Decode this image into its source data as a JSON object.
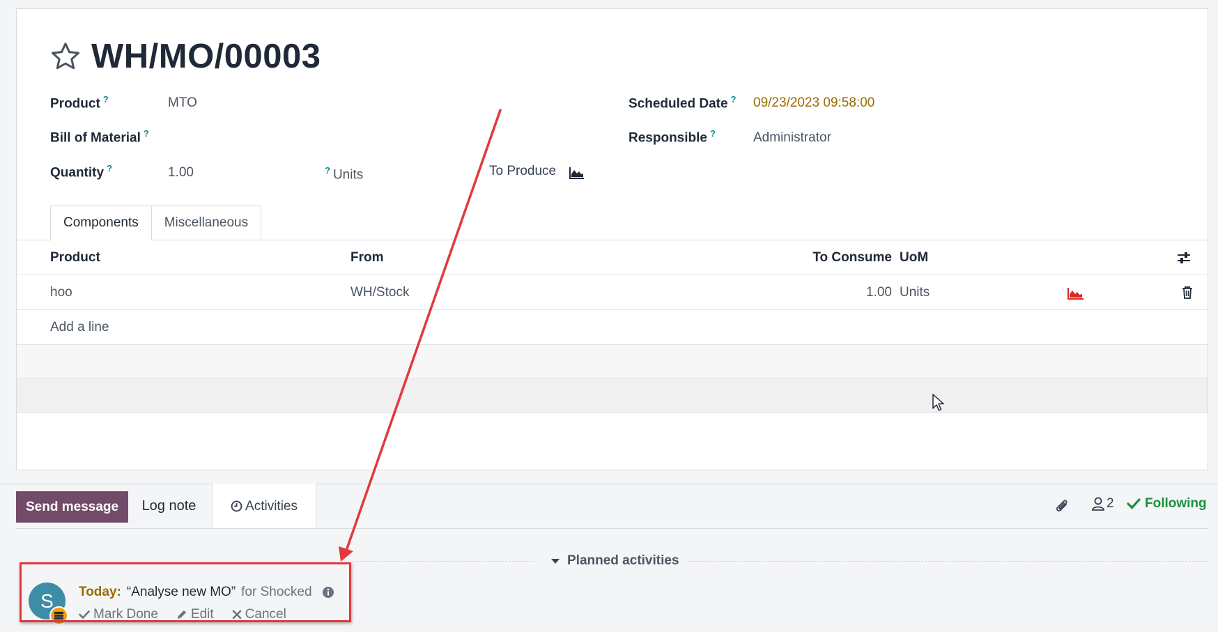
{
  "record": {
    "title": "WH/MO/00003",
    "fields": {
      "product_label": "Product",
      "product_value": "MTO",
      "bom_label": "Bill of Material",
      "quantity_label": "Quantity",
      "quantity_value": "1.00",
      "quantity_uom": "Units",
      "to_produce_label": "To Produce",
      "scheduled_label": "Scheduled Date",
      "scheduled_value": "09/23/2023 09:58:00",
      "responsible_label": "Responsible",
      "responsible_value": "Administrator",
      "help_mark": "?"
    }
  },
  "tabs": [
    {
      "label": "Components",
      "active": true
    },
    {
      "label": "Miscellaneous",
      "active": false
    }
  ],
  "components_table": {
    "headers": {
      "product": "Product",
      "from": "From",
      "to_consume": "To Consume",
      "uom": "UoM"
    },
    "rows": [
      {
        "product": "hoo",
        "from": "WH/Stock",
        "to_consume": "1.00",
        "uom": "Units"
      }
    ],
    "add_line": "Add a line"
  },
  "chatter": {
    "send_message": "Send message",
    "log_note": "Log note",
    "activities": "Activities",
    "followers_count": "2",
    "following": "Following",
    "planned_activities": "Planned activities"
  },
  "activity": {
    "avatar_initial": "S",
    "due": "Today:",
    "summary": "“Analyse new MO”",
    "for_user": "for Shocked",
    "mark_done": "Mark Done",
    "edit": "Edit",
    "cancel": "Cancel"
  },
  "colors": {
    "primary": "#714b67",
    "link": "#0b7b83",
    "date": "#9a6b00",
    "following": "#1e8e3e",
    "annotation": "#e0393e"
  }
}
